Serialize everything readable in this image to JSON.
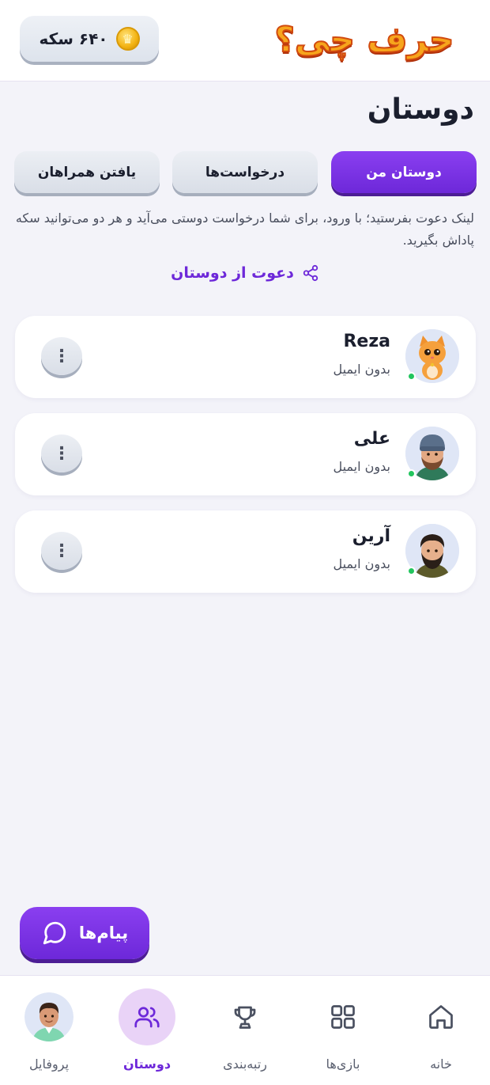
{
  "header": {
    "logo_text": "حرف چی؟",
    "coins_label": "۶۴۰ سکه"
  },
  "page": {
    "title": "دوستان"
  },
  "tabs": [
    {
      "label": "دوستان من",
      "active": true
    },
    {
      "label": "درخواست‌ها",
      "active": false
    },
    {
      "label": "یافتن همراهان",
      "active": false
    }
  ],
  "info_text": "لینک دعوت بفرستید؛ با ورود، برای شما درخواست دوستی می‌آید و هر دو می‌توانید سکه پاداش بگیرید.",
  "invite": {
    "label": "دعوت از دوستان",
    "icon": "share-icon"
  },
  "friends": [
    {
      "name": "Reza",
      "subtitle": "بدون ایمیل",
      "online": true,
      "avatar": "cat-avatar"
    },
    {
      "name": "علی",
      "subtitle": "بدون ایمیل",
      "online": true,
      "avatar": "man-beanie-avatar"
    },
    {
      "name": "آرین",
      "subtitle": "بدون ایمیل",
      "online": true,
      "avatar": "man-beard-avatar"
    }
  ],
  "messages_button": {
    "label": "پیام‌ها",
    "icon": "chat-icon"
  },
  "bottom_nav": [
    {
      "label": "خانه",
      "icon": "home-icon",
      "active": false
    },
    {
      "label": "بازی‌ها",
      "icon": "grid-icon",
      "active": false
    },
    {
      "label": "رتبه‌بندی",
      "icon": "trophy-icon",
      "active": false
    },
    {
      "label": "دوستان",
      "icon": "users-icon",
      "active": true
    },
    {
      "label": "پروفایل",
      "icon": "profile-avatar",
      "active": false
    }
  ],
  "colors": {
    "accent": "#6d28d9",
    "background": "#f3f3f9",
    "online": "#22c55e"
  }
}
